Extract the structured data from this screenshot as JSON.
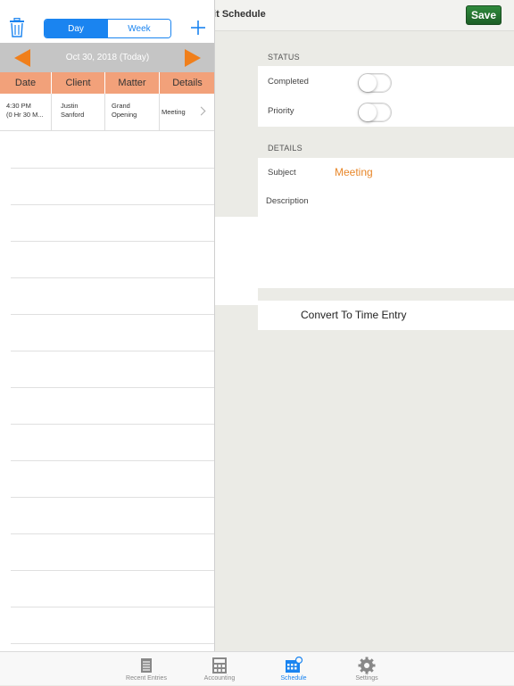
{
  "detail": {
    "title": "lit Schedule",
    "save_label": "Save",
    "status_section": "STATUS",
    "completed_label": "Completed",
    "completed_on": false,
    "priority_label": "Priority",
    "priority_on": false,
    "details_section": "DETAILS",
    "subject_label": "Subject",
    "subject_value": "Meeting",
    "description_label": "Description",
    "convert_label": "Convert To Time Entry",
    "accent_color": "#e8872a"
  },
  "popover": {
    "segments": [
      {
        "label": "Day",
        "active": true
      },
      {
        "label": "Week",
        "active": false
      }
    ],
    "date_label": "Oct 30, 2018 (Today)",
    "columns": [
      "Date",
      "Client",
      "Matter",
      "Details"
    ],
    "entries": [
      {
        "date_line1": "4:30 PM",
        "date_line2": "(0 Hr 30 M...",
        "client_line1": "Justin",
        "client_line2": "Sanford",
        "matter_line1": "Grand",
        "matter_line2": "Opening",
        "details": "Meeting"
      }
    ],
    "header_color": "#f2a17a",
    "arrow_color": "#f07f1b",
    "segment_color": "#1a84f0"
  },
  "tabbar": {
    "tabs": [
      {
        "label": "Recent Entries",
        "icon": "list-icon",
        "active": false
      },
      {
        "label": "Accounting",
        "icon": "calculator-icon",
        "active": false
      },
      {
        "label": "Schedule",
        "icon": "calendar-icon",
        "active": true
      },
      {
        "label": "Settings",
        "icon": "gear-icon",
        "active": false
      }
    ]
  }
}
